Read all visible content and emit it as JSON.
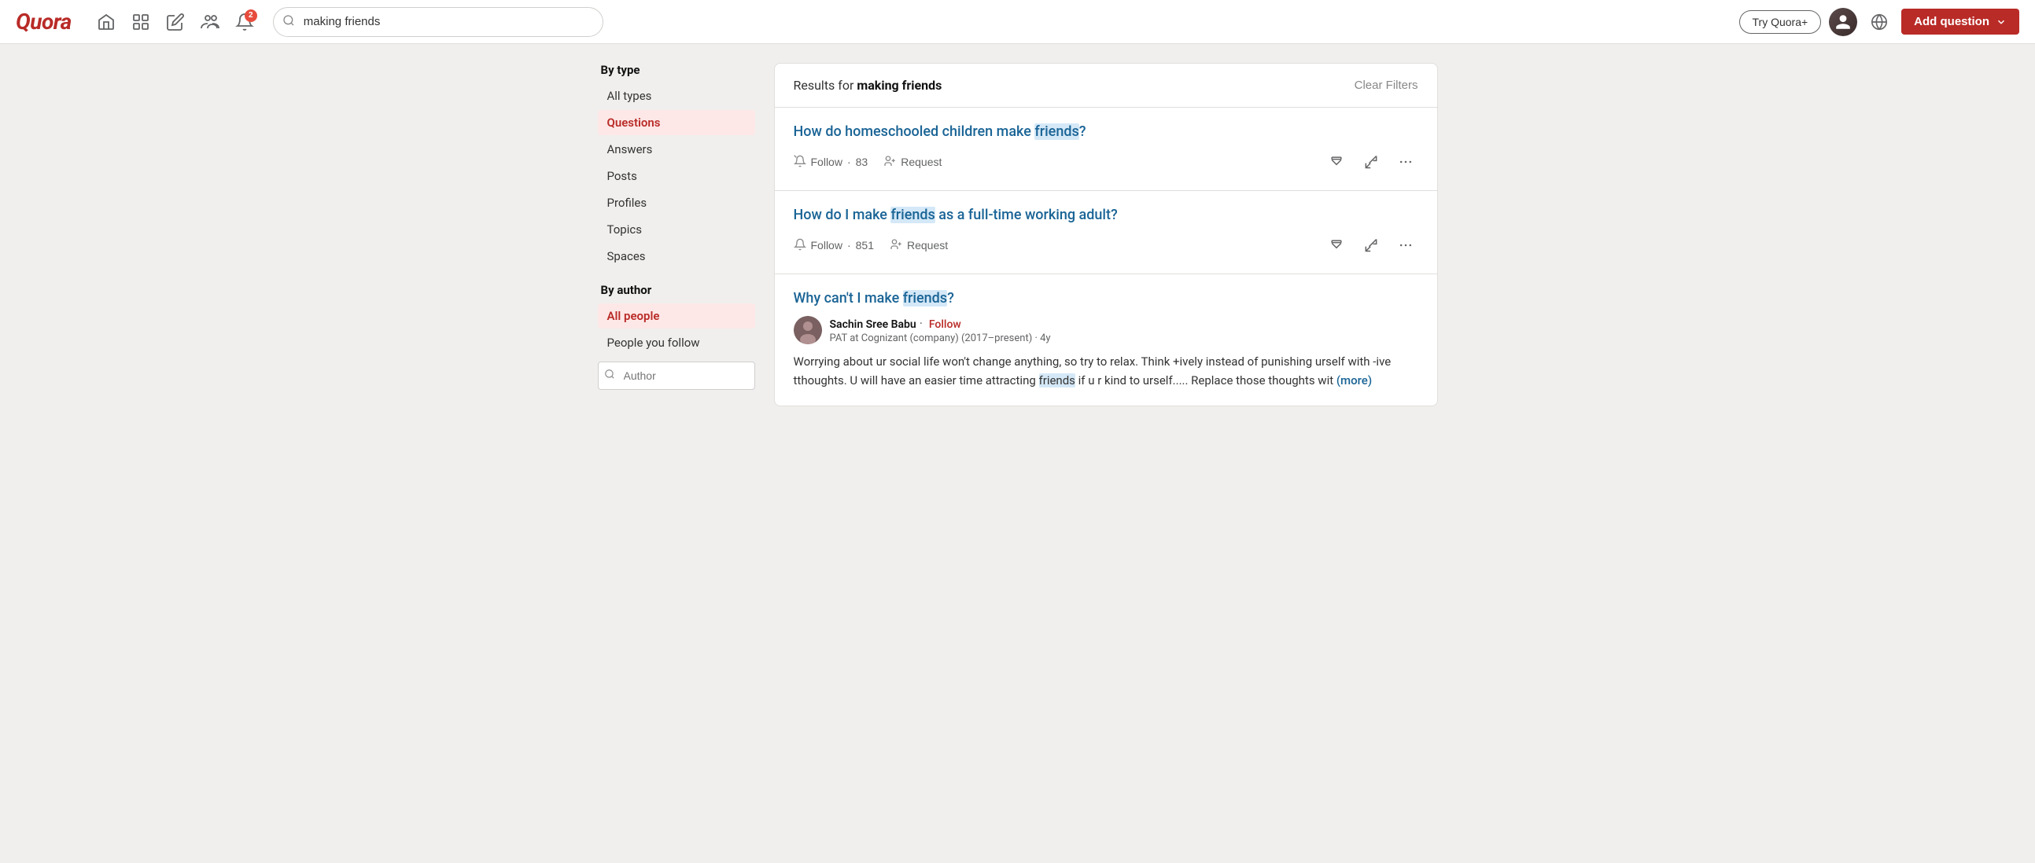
{
  "brand": {
    "logo": "Quora"
  },
  "header": {
    "search_placeholder": "making friends",
    "search_value": "making friends",
    "try_quora_label": "Try Quora+",
    "add_question_label": "Add question",
    "notification_count": "2",
    "nav_icons": [
      "home-icon",
      "feed-icon",
      "edit-icon",
      "spaces-icon",
      "bell-icon"
    ]
  },
  "sidebar": {
    "by_type_title": "By type",
    "by_author_title": "By author",
    "type_items": [
      {
        "label": "All types",
        "active": false,
        "key": "all-types"
      },
      {
        "label": "Questions",
        "active": true,
        "key": "questions"
      },
      {
        "label": "Answers",
        "active": false,
        "key": "answers"
      },
      {
        "label": "Posts",
        "active": false,
        "key": "posts"
      },
      {
        "label": "Profiles",
        "active": false,
        "key": "profiles"
      },
      {
        "label": "Topics",
        "active": false,
        "key": "topics"
      },
      {
        "label": "Spaces",
        "active": false,
        "key": "spaces"
      }
    ],
    "author_items": [
      {
        "label": "All people",
        "active": true,
        "key": "all-people"
      },
      {
        "label": "People you follow",
        "active": false,
        "key": "people-you-follow"
      }
    ],
    "author_input_placeholder": "Author"
  },
  "results": {
    "header_prefix": "Results for ",
    "header_query": "making friends",
    "clear_filters_label": "Clear Filters",
    "items": [
      {
        "type": "question",
        "title": "How do homeschooled children make friends?",
        "title_highlight": "friends",
        "follow_count": "83",
        "follow_label": "Follow",
        "request_label": "Request",
        "key": "result-1"
      },
      {
        "type": "question",
        "title": "How do I make friends as a full-time working adult?",
        "title_highlight": "friends",
        "follow_count": "851",
        "follow_label": "Follow",
        "request_label": "Request",
        "key": "result-2"
      },
      {
        "type": "answer",
        "title": "Why can't I make friends?",
        "title_highlight": "friends",
        "author_name": "Sachin Sree Babu",
        "author_follow_label": "Follow",
        "author_meta": "PAT at Cognizant (company) (2017–present) · 4y",
        "answer_text": "Worrying about ur social life won't change anything, so try to relax. Think +ively instead of punishing urself with -ive tthoughts. U will have an easier time attracting friends if u r kind to urself..... Replace those thoughts wit",
        "answer_highlight": "friends",
        "more_label": "(more)",
        "key": "result-3"
      }
    ]
  }
}
